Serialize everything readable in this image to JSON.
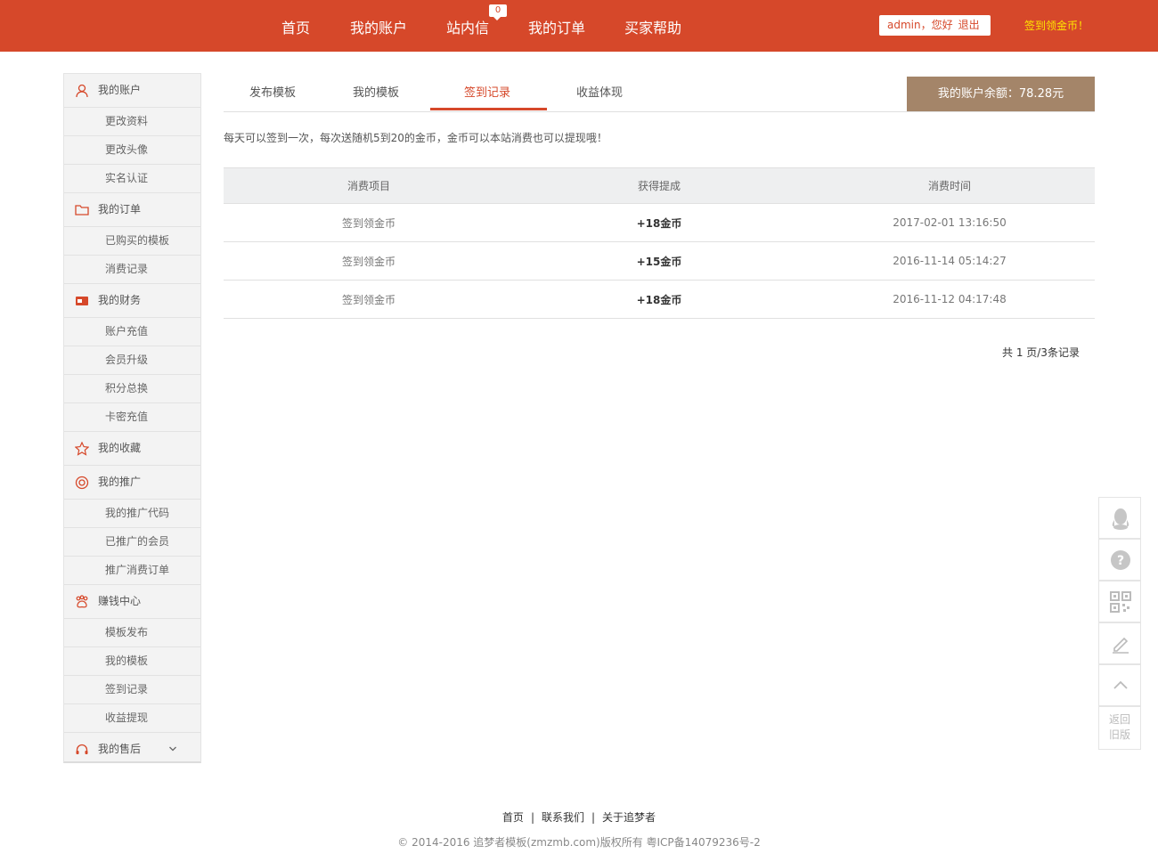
{
  "header": {
    "nav": [
      "首页",
      "我的账户",
      "站内信",
      "我的订单",
      "买家帮助"
    ],
    "message_count": "0",
    "user": "admin，您好",
    "logout": "退出",
    "signin_link": "签到领金币！"
  },
  "sidebar": {
    "groups": [
      {
        "label": "我的账户",
        "icon": "user-icon",
        "items": [
          "更改资料",
          "更改头像",
          "实名认证"
        ]
      },
      {
        "label": "我的订单",
        "icon": "folder-icon",
        "items": [
          "已购买的模板",
          "消费记录"
        ]
      },
      {
        "label": "我的财务",
        "icon": "card-icon",
        "items": [
          "账户充值",
          "会员升级",
          "积分总换",
          "卡密充值"
        ]
      },
      {
        "label": "我的收藏",
        "icon": "star-icon",
        "items": []
      },
      {
        "label": "我的推广",
        "icon": "target-icon",
        "items": [
          "我的推广代码",
          "已推广的会员",
          "推广消费订单"
        ]
      },
      {
        "label": "赚钱中心",
        "icon": "paw-icon",
        "items": [
          "模板发布",
          "我的模板",
          "签到记录",
          "收益提现"
        ]
      },
      {
        "label": "我的售后",
        "icon": "headset-icon",
        "items": []
      }
    ]
  },
  "tabs": [
    "发布模板",
    "我的模板",
    "签到记录",
    "收益体现"
  ],
  "active_tab": "签到记录",
  "balance": "我的账户余额：78.28元",
  "notice": "每天可以签到一次，每次送随机5到20的金币，金币可以本站消费也可以提现哦！",
  "table": {
    "headers": [
      "消费项目",
      "获得提成",
      "消费时间"
    ],
    "rows": [
      [
        "签到领金币",
        "+18金币",
        "2017-02-01 13:16:50"
      ],
      [
        "签到领金币",
        "+15金币",
        "2016-11-14 05:14:27"
      ],
      [
        "签到领金币",
        "+18金币",
        "2016-11-12 04:17:48"
      ]
    ]
  },
  "pager": "共 1 页/3条记录",
  "float_bar": {
    "back_line1": "返回",
    "back_line2": "旧版"
  },
  "footer": {
    "links": [
      "首页",
      "联系我们",
      "关于追梦者"
    ],
    "separator": "|",
    "copyright": "© 2014-2016 追梦者模板(zmzmb.com)版权所有 粤ICP备14079236号-2"
  },
  "colors": {
    "brand": "#d6482a",
    "balance_bg": "#a48569",
    "signin_link": "#ffe600"
  }
}
